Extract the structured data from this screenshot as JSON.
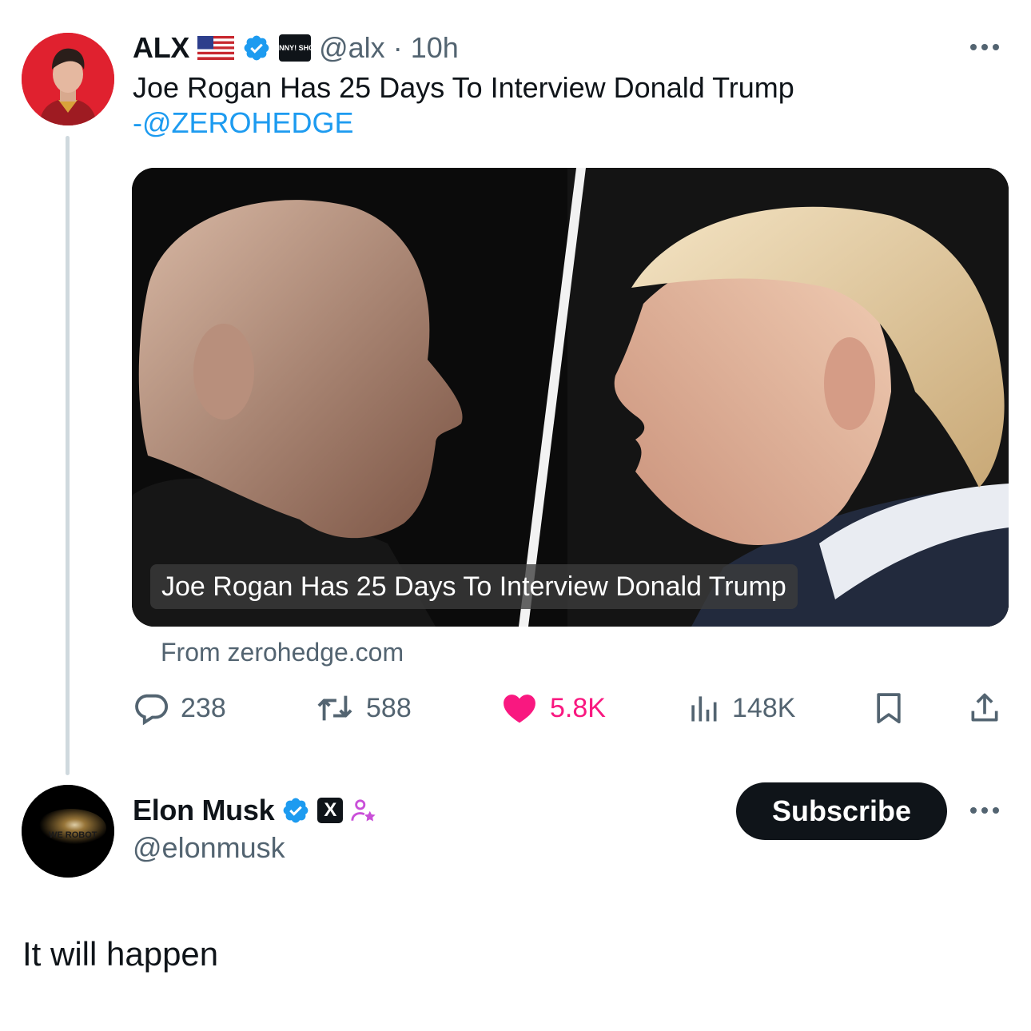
{
  "tweet": {
    "display_name": "ALX",
    "handle": "@alx",
    "separator": "·",
    "time": "10h",
    "affiliate_badge": "BENNY! SHOW",
    "text": "Joe Rogan Has 25 Days To Interview Donald Trump",
    "mention": "-@ZEROHEDGE",
    "card": {
      "caption": "Joe Rogan Has 25 Days To Interview Donald Trump",
      "source": "From zerohedge.com"
    },
    "stats": {
      "replies": "238",
      "retweets": "588",
      "likes": "5.8K",
      "views": "148K"
    }
  },
  "reply": {
    "display_name": "Elon Musk",
    "handle": "@elonmusk",
    "x_badge": "X",
    "subscribe_label": "Subscribe",
    "text": "It will happen",
    "avatar_text": "WE ROBOT"
  },
  "colors": {
    "accent_blue": "#1d9bf0",
    "like_pink": "#f91880",
    "muted_gray": "#536471",
    "text_dark": "#0f1419",
    "alx_avatar_red": "#e0212f",
    "subscriber_purple": "#c94fd8"
  }
}
